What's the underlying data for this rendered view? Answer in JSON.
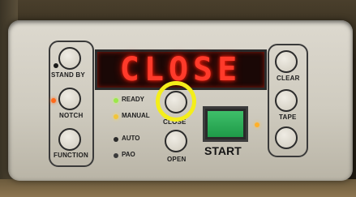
{
  "display": {
    "text": "CLOSE"
  },
  "left_buttons": [
    {
      "label": "STAND BY"
    },
    {
      "label": "NOTCH"
    },
    {
      "label": "FUNCTION"
    }
  ],
  "right_buttons": [
    {
      "label": "CLEAR"
    },
    {
      "label": "TAPE"
    },
    {
      "label": ""
    }
  ],
  "status": [
    {
      "label": "READY",
      "led_color": "#9be84a"
    },
    {
      "label": "MANUAL",
      "led_color": "#f2c53a"
    },
    {
      "label": "AUTO",
      "led_color": "#2a2a2a"
    },
    {
      "label": "PAO",
      "led_color": "#3a3a3a"
    }
  ],
  "center_buttons": {
    "close_label": "CLOSE",
    "open_label": "OPEN"
  },
  "start": {
    "label": "START",
    "key_color": "#2fae58"
  },
  "highlight_color": "#f4ee1a"
}
